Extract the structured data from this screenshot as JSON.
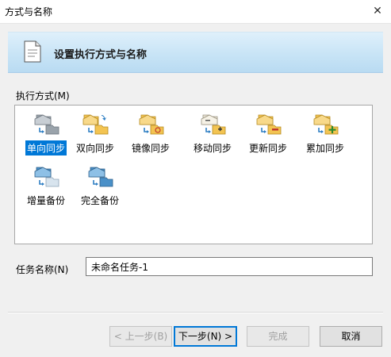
{
  "window": {
    "title": "方式与名称",
    "close_glyph": "✕",
    "close_icon": "close-icon"
  },
  "banner": {
    "icon": "document-icon",
    "title": "设置执行方式与名称"
  },
  "execution_mode": {
    "label": "执行方式(M)",
    "selected": "单向同步",
    "items": [
      {
        "label": "单向同步",
        "icon": "one-way-sync-icon"
      },
      {
        "label": "双向同步",
        "icon": "two-way-sync-icon"
      },
      {
        "label": "镜像同步",
        "icon": "mirror-sync-icon"
      },
      {
        "label": "移动同步",
        "icon": "move-sync-icon"
      },
      {
        "label": "更新同步",
        "icon": "update-sync-icon"
      },
      {
        "label": "累加同步",
        "icon": "cumulative-sync-icon"
      },
      {
        "label": "增量备份",
        "icon": "incremental-backup-icon"
      },
      {
        "label": "完全备份",
        "icon": "full-backup-icon"
      }
    ]
  },
  "task_name": {
    "label": "任务名称(N)",
    "value": "未命名任务-1"
  },
  "buttons": {
    "prev": "< 上一步(B)",
    "next": "下一步(N) >",
    "finish": "完成",
    "cancel": "取消"
  },
  "colors": {
    "selection": "#0078d7",
    "banner": "#c8e4f6",
    "folder_yellow": "#f3c452",
    "folder_gray": "#9aa3ab",
    "folder_blue": "#4a90c8",
    "arrow_blue": "#2f7fc3"
  }
}
